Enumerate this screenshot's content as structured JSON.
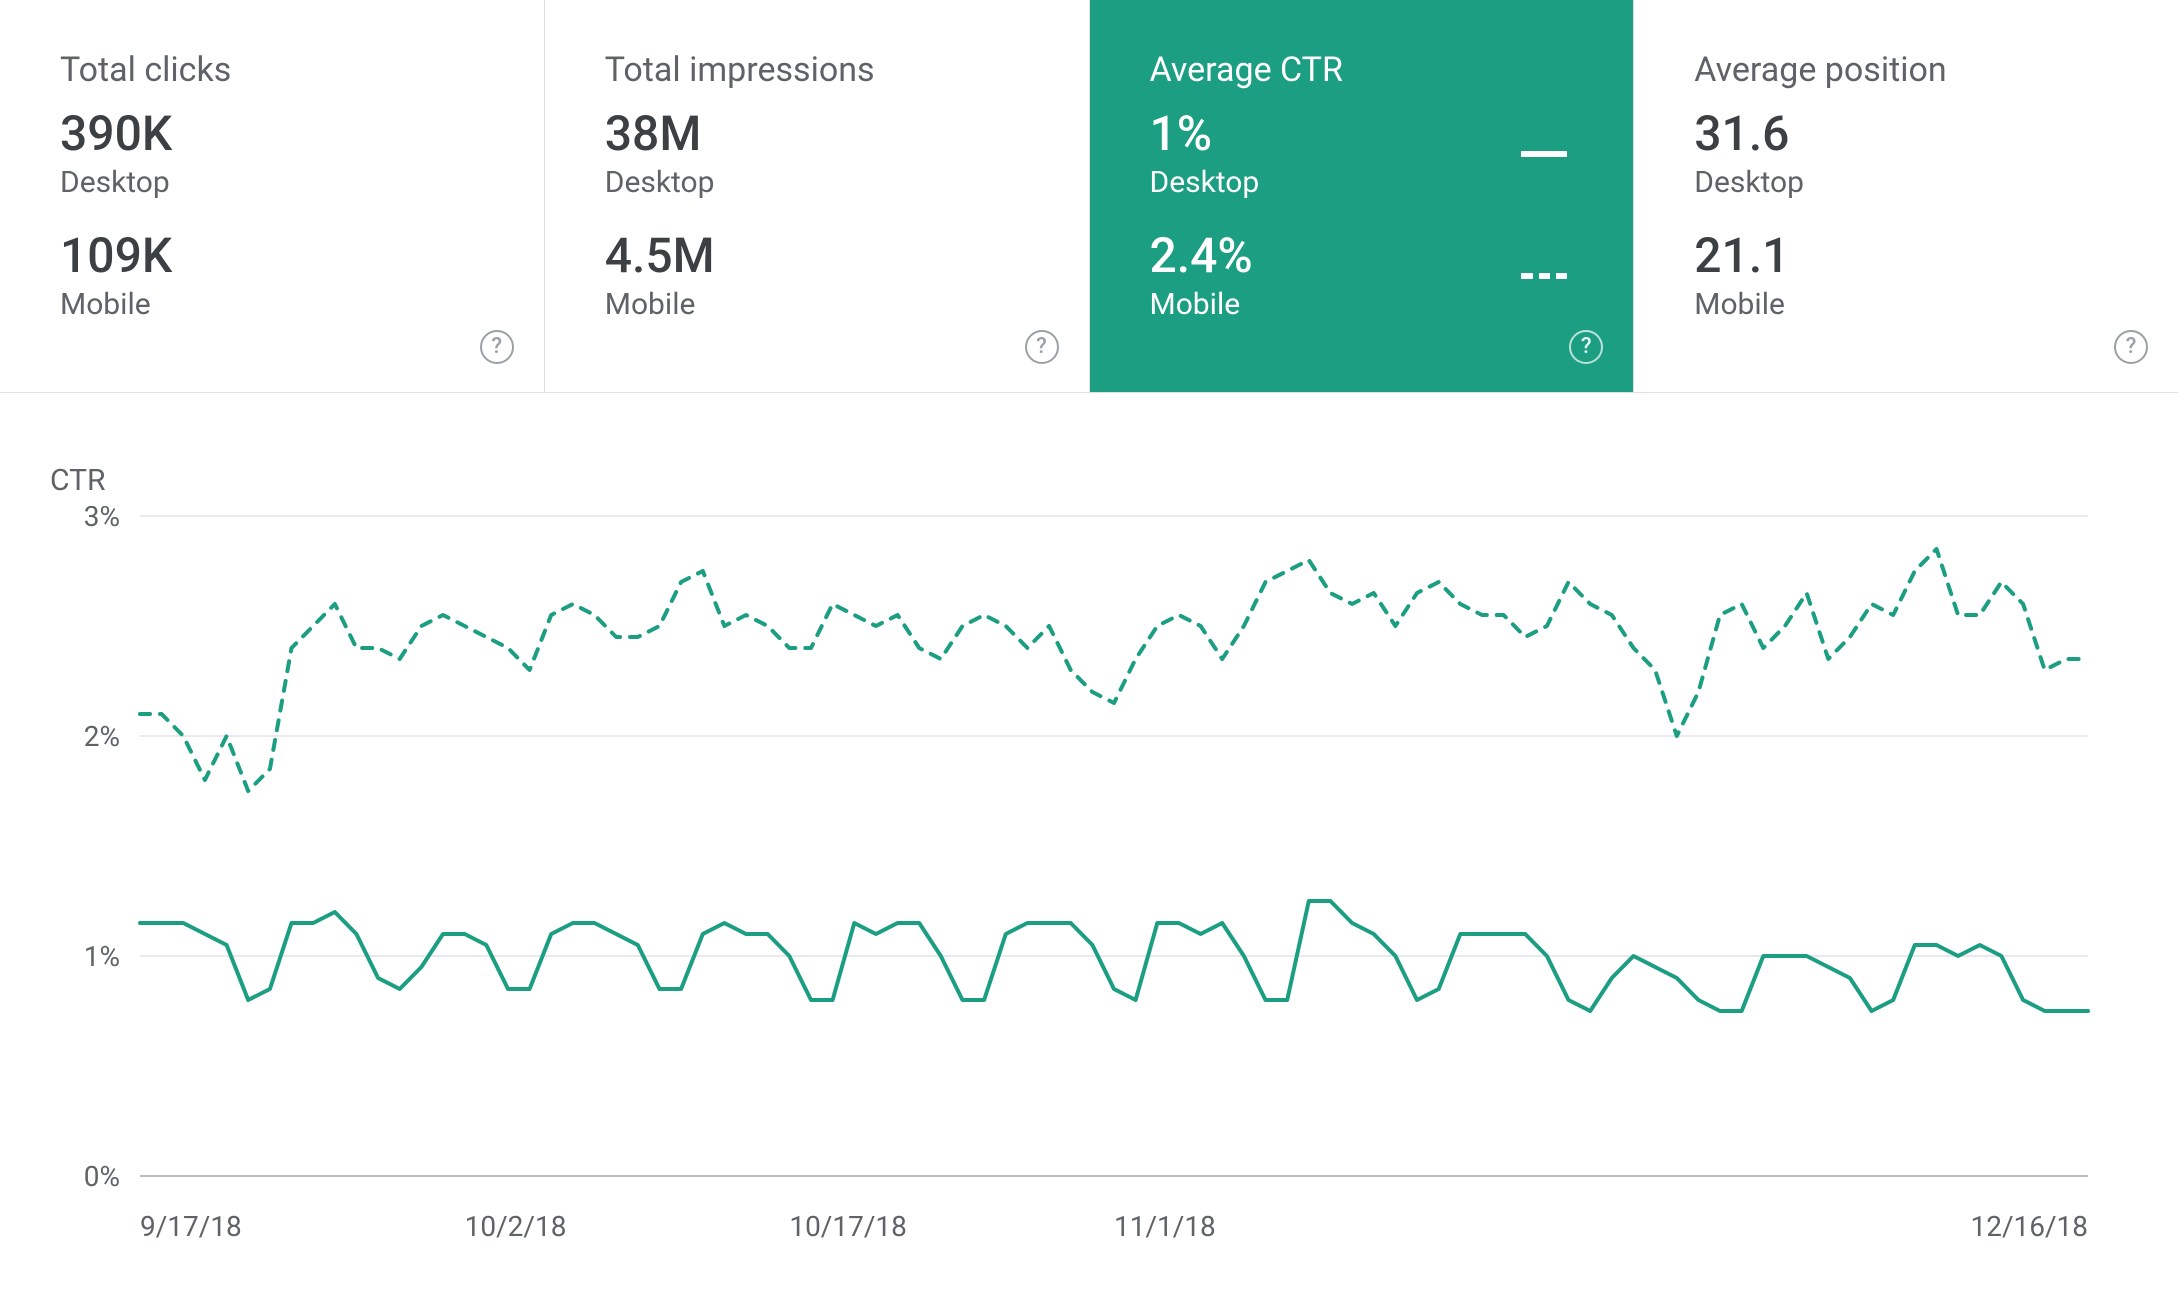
{
  "cards": [
    {
      "id": "clicks",
      "title": "Total clicks",
      "desktop_value": "390K",
      "desktop_label": "Desktop",
      "mobile_value": "109K",
      "mobile_label": "Mobile",
      "active": false
    },
    {
      "id": "impressions",
      "title": "Total impressions",
      "desktop_value": "38M",
      "desktop_label": "Desktop",
      "mobile_value": "4.5M",
      "mobile_label": "Mobile",
      "active": false
    },
    {
      "id": "ctr",
      "title": "Average CTR",
      "desktop_value": "1%",
      "desktop_label": "Desktop",
      "mobile_value": "2.4%",
      "mobile_label": "Mobile",
      "active": true
    },
    {
      "id": "position",
      "title": "Average position",
      "desktop_value": "31.6",
      "desktop_label": "Desktop",
      "mobile_value": "21.1",
      "mobile_label": "Mobile",
      "active": false
    }
  ],
  "chart_axis": {
    "title": "CTR",
    "y_ticks": [
      "3%",
      "2%",
      "1%",
      "0%"
    ],
    "x_ticks": [
      "9/17/18",
      "10/2/18",
      "10/17/18",
      "11/1/18",
      "12/16/18"
    ]
  },
  "chart_data": {
    "type": "line",
    "title": "CTR",
    "xlabel": "",
    "ylabel": "CTR",
    "ylim": [
      0,
      3
    ],
    "x_start": "9/17/18",
    "x_end": "12/16/18",
    "x_tick_labels": [
      "9/17/18",
      "10/2/18",
      "10/17/18",
      "11/1/18",
      "12/16/18"
    ],
    "series": [
      {
        "name": "Desktop",
        "style": "solid",
        "values": [
          1.15,
          1.15,
          1.15,
          1.1,
          1.05,
          0.8,
          0.85,
          1.15,
          1.15,
          1.2,
          1.1,
          0.9,
          0.85,
          0.95,
          1.1,
          1.1,
          1.05,
          0.85,
          0.85,
          1.1,
          1.15,
          1.15,
          1.1,
          1.05,
          0.85,
          0.85,
          1.1,
          1.15,
          1.1,
          1.1,
          1.0,
          0.8,
          0.8,
          1.15,
          1.1,
          1.15,
          1.15,
          1.0,
          0.8,
          0.8,
          1.1,
          1.15,
          1.15,
          1.15,
          1.05,
          0.85,
          0.8,
          1.15,
          1.15,
          1.1,
          1.15,
          1.0,
          0.8,
          0.8,
          1.25,
          1.25,
          1.15,
          1.1,
          1.0,
          0.8,
          0.85,
          1.1,
          1.1,
          1.1,
          1.1,
          1.0,
          0.8,
          0.75,
          0.9,
          1.0,
          0.95,
          0.9,
          0.8,
          0.75,
          0.75,
          1.0,
          1.0,
          1.0,
          0.95,
          0.9,
          0.75,
          0.8,
          1.05,
          1.05,
          1.0,
          1.05,
          1.0,
          0.8,
          0.75,
          0.75,
          0.75
        ]
      },
      {
        "name": "Mobile",
        "style": "dashed",
        "values": [
          2.1,
          2.1,
          2.0,
          1.8,
          2.0,
          1.75,
          1.85,
          2.4,
          2.5,
          2.6,
          2.4,
          2.4,
          2.35,
          2.5,
          2.55,
          2.5,
          2.45,
          2.4,
          2.3,
          2.55,
          2.6,
          2.55,
          2.45,
          2.45,
          2.5,
          2.7,
          2.75,
          2.5,
          2.55,
          2.5,
          2.4,
          2.4,
          2.6,
          2.55,
          2.5,
          2.55,
          2.4,
          2.35,
          2.5,
          2.55,
          2.5,
          2.4,
          2.5,
          2.3,
          2.2,
          2.15,
          2.35,
          2.5,
          2.55,
          2.5,
          2.35,
          2.5,
          2.7,
          2.75,
          2.8,
          2.65,
          2.6,
          2.65,
          2.5,
          2.65,
          2.7,
          2.6,
          2.55,
          2.55,
          2.45,
          2.5,
          2.7,
          2.6,
          2.55,
          2.4,
          2.3,
          2.0,
          2.2,
          2.55,
          2.6,
          2.4,
          2.5,
          2.65,
          2.35,
          2.45,
          2.6,
          2.55,
          2.75,
          2.85,
          2.55,
          2.55,
          2.7,
          2.6,
          2.3,
          2.35,
          2.35
        ]
      }
    ]
  }
}
